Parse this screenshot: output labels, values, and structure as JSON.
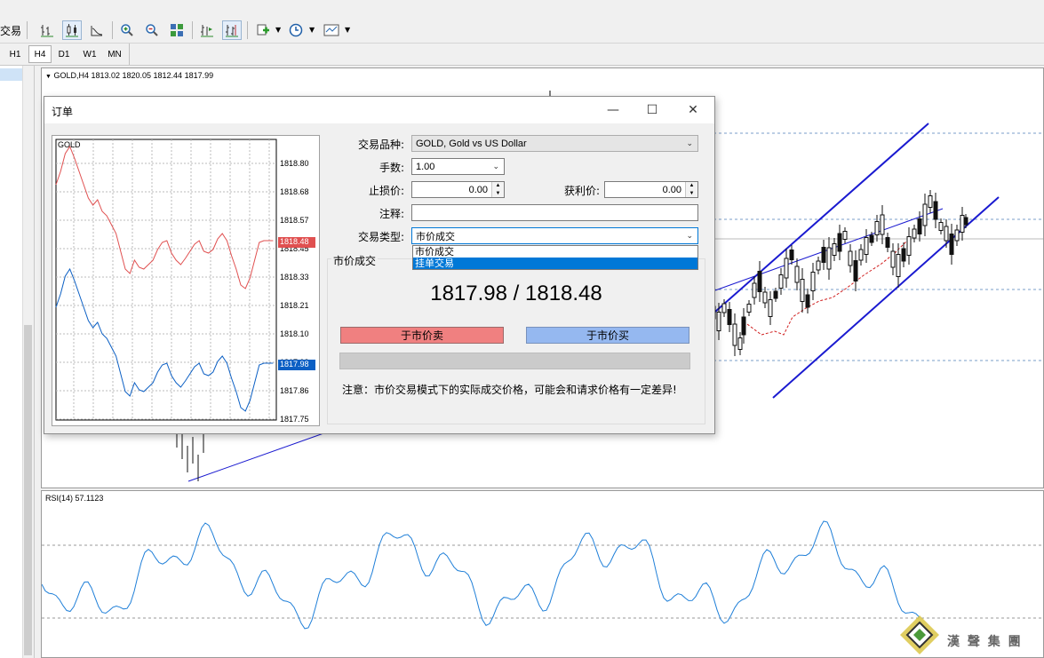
{
  "toolbar": {
    "trade_label": "交易",
    "timeframes": [
      "H1",
      "H4",
      "D1",
      "W1",
      "MN"
    ],
    "active_timeframe": "H4"
  },
  "chart": {
    "header": "GOLD,H4  1813.02 1820.05 1812.44 1817.99",
    "rsi_header": "RSI(14) 57.1123"
  },
  "dialog": {
    "title": "订单",
    "symbol_label": "交易品种:",
    "symbol_value": "GOLD, Gold vs US Dollar",
    "volume_label": "手数:",
    "volume_value": "1.00",
    "sl_label": "止损价:",
    "sl_value": "0.00",
    "tp_label": "获利价:",
    "tp_value": "0.00",
    "comment_label": "注释:",
    "comment_value": "",
    "type_label": "交易类型:",
    "type_value": "市价成交",
    "type_options": [
      "市价成交",
      "挂单交易"
    ],
    "selected_option": "挂单交易",
    "group_label": "市价成交",
    "price_text": "1817.98 / 1818.48",
    "sell_button": "于市价卖",
    "buy_button": "于市价买",
    "note": "注意：市价交易模式下的实际成交价格，可能会和请求价格有一定差异!",
    "mini_chart": {
      "symbol": "GOLD",
      "price_ticks": [
        "1818.80",
        "1818.68",
        "1818.57",
        "1818.45",
        "1818.33",
        "1818.21",
        "1818.10",
        "1817.98",
        "1817.86",
        "1817.75"
      ],
      "ask_tag": "1818.48",
      "bid_tag": "1817.98",
      "ask_color": "#e05050",
      "bid_color": "#0b5fc4"
    }
  },
  "watermark": {
    "text": "漢 聲 集 團"
  }
}
